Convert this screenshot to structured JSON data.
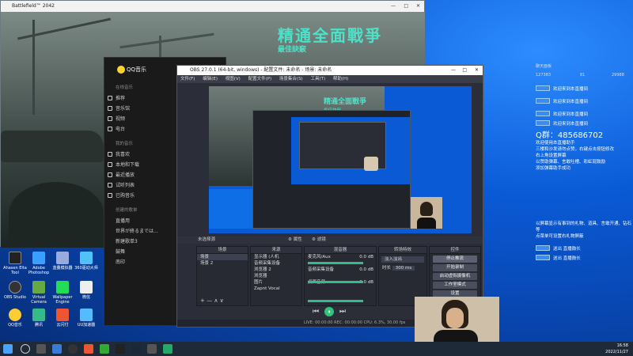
{
  "battlefield_window": {
    "title": "Battlefield™ 2042",
    "heading": "精通全面戰爭",
    "subheading": "最佳訣竅"
  },
  "qq_music": {
    "app_name": "QQ音乐",
    "section_online": "在线音乐",
    "nav": [
      "推荐",
      "音乐馆",
      "视频",
      "电台"
    ],
    "section_mine": "我的音乐",
    "mine_items": [
      "我喜欢",
      "本地和下载",
      "最近播放",
      "试听列表",
      "已购音乐"
    ],
    "section_playlists": "创建的歌单",
    "playlists": [
      "直播用",
      "世界が終るまでは...",
      "新建歌单3",
      "鼓舞",
      "南印"
    ]
  },
  "obs": {
    "title": "OBS 27.0.1 (64-bit, windows) - 配置文件: 未命名 - 场景: 未命名",
    "menu": [
      "文件(F)",
      "编辑(E)",
      "视图(V)",
      "配置文件(P)",
      "场景集合(S)",
      "工具(T)",
      "帮助(H)"
    ],
    "no_source": "未选择源",
    "props_label": "属性",
    "filters_label": "滤镜",
    "docks": {
      "scenes": "场景",
      "sources": "来源",
      "mixer": "混音器",
      "transitions": "转场特效",
      "controls": "控件"
    },
    "scenes": [
      "场景",
      "场景 2"
    ],
    "sources": [
      "显示器 (人机",
      "音频采集设备",
      "浏览器 2",
      "浏览器",
      "图片",
      "Zapnt Vocal"
    ],
    "mixer": [
      {
        "name": "麦克风/Aux",
        "level": "0.0 dB"
      },
      {
        "name": "音频采集设备",
        "level": "0.0 dB"
      },
      {
        "name": "桌面音频",
        "level": "0.0 dB"
      }
    ],
    "transition": "淡入淡出",
    "duration_label": "时长",
    "duration_value": "300 ms",
    "controls": [
      "停止推流",
      "开始录制",
      "启动虚拟摄像机",
      "工作室模式",
      "设置",
      "退出"
    ],
    "status": "LIVE: 00:00:00   REC: 00:00:00   CPU: 6.3%, 30.00 fps"
  },
  "stream_preview": {
    "heading": "精通全面戰爭",
    "subheading": "最佳訣竅"
  },
  "chat": {
    "header_left": "聊天面板",
    "header_right": "主播",
    "stats": [
      "127383",
      "81",
      "29988"
    ],
    "messages": [
      "欢迎来到本直播间",
      "欢迎来到本直播间",
      "欢迎来到本直播间",
      "欢迎来到本直播间",
      "欢迎来到本直播间"
    ],
    "qq_number_label": "Q群：",
    "qq_number": "485686702",
    "notice_lines": [
      "欢迎使用本直播助手",
      "三楼和沙发请勿点赞，右键点击按钮修改",
      "右上角设置屏幕",
      "以赞助弹幕、言敢吐槽、彩虹屁鼓励",
      "添加弹幕助手成功"
    ],
    "footer_lines": [
      "以屏幕显示有事到的礼物、道具、言敢开通、钻石",
      "等",
      "点菜单可设置右礼物屏蔽"
    ],
    "gift_messages": [
      "送出 直播鼓长",
      "送出 直播鼓长"
    ]
  },
  "desktop_icons": [
    "Ahasen Elta Tool",
    "Adobe Photoshop",
    "蓝叠模拟器",
    "360驱动大师",
    "OBS Studio",
    "Virtual Camera",
    "Wallpaper Engine",
    "微信",
    "QQ音乐",
    "腾讯",
    "云闪付",
    "UU加速器"
  ],
  "taskbar": {
    "time": "16:58",
    "date": "2022/11/27"
  },
  "colors": {
    "desktop_blue": "#0a5ad6",
    "obs_bg": "#2b2e38",
    "qq_bg": "#1a1a1a",
    "accent_teal": "#4ee0c8"
  }
}
